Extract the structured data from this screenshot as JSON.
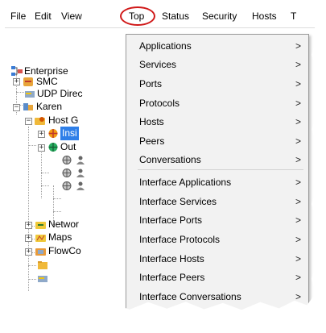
{
  "menubar": {
    "items": [
      {
        "label": "File"
      },
      {
        "label": "Edit"
      },
      {
        "label": "View"
      },
      {
        "label": "Top"
      },
      {
        "label": "Status"
      },
      {
        "label": "Security"
      },
      {
        "label": "Hosts"
      },
      {
        "label": "T"
      }
    ],
    "highlight_color": "#d01818"
  },
  "tree": {
    "nodes": [
      {
        "label": "Enterprise",
        "icon": "enterprise-icon"
      },
      {
        "label": "SMC",
        "icon": "smc-icon"
      },
      {
        "label": "UDP Direc",
        "icon": "udp-director-icon"
      },
      {
        "label": "Karen",
        "icon": "domain-icon"
      },
      {
        "label": "Host G",
        "icon": "host-groups-icon"
      },
      {
        "label": "Insi",
        "icon": "inside-hosts-icon",
        "selected": true
      },
      {
        "label": "Out",
        "icon": "outside-hosts-icon"
      },
      {
        "label": "Networ",
        "icon": "network-devices-icon"
      },
      {
        "label": "Maps",
        "icon": "maps-icon"
      },
      {
        "label": "FlowCo",
        "icon": "flowcollector-icon"
      }
    ],
    "selection_color": "#2f7fe8"
  },
  "top_menu": {
    "items": [
      {
        "label": "Applications",
        "arrow": ">"
      },
      {
        "label": "Services",
        "arrow": ">"
      },
      {
        "label": "Ports",
        "arrow": ">"
      },
      {
        "label": "Protocols",
        "arrow": ">"
      },
      {
        "label": "Hosts",
        "arrow": ">"
      },
      {
        "label": "Peers",
        "arrow": ">"
      },
      {
        "label": "Conversations",
        "arrow": ">"
      },
      {
        "label": "Interface Applications",
        "arrow": ">"
      },
      {
        "label": "Interface Services",
        "arrow": ">"
      },
      {
        "label": "Interface Ports",
        "arrow": ">"
      },
      {
        "label": "Interface Protocols",
        "arrow": ">"
      },
      {
        "label": "Interface Hosts",
        "arrow": ">"
      },
      {
        "label": "Interface Peers",
        "arrow": ">"
      },
      {
        "label": "Interface Conversations",
        "arrow": ">"
      }
    ]
  }
}
